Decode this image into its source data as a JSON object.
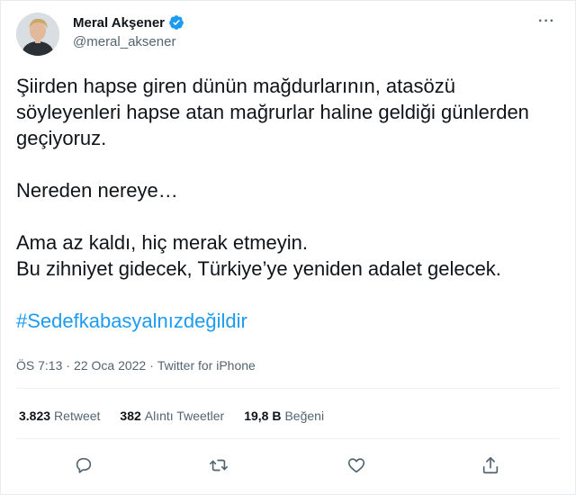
{
  "author": {
    "name": "Meral Akşener",
    "handle": "@meral_aksener",
    "verified_icon": "verified-badge-icon"
  },
  "tweet": {
    "paragraphs": [
      "Şiirden hapse giren dünün mağdurlarının, atasözü söyleyenleri hapse atan mağrurlar haline geldiği günlerden geçiyoruz.",
      "Nereden nereye…",
      "Ama az kaldı, hiç merak etmeyin.",
      "Bu zihniyet gidecek, Türkiye’ye yeniden adalet gelecek."
    ],
    "hashtag": "#Sedefkabasyalnızdeğildir"
  },
  "meta": {
    "time": "ÖS 7:13",
    "date": "22 Oca 2022",
    "source": "Twitter for iPhone"
  },
  "stats": {
    "retweets_value": "3.823",
    "retweets_label": "Retweet",
    "quotes_value": "382",
    "quotes_label": "Alıntı Tweetler",
    "likes_value": "19,8 B",
    "likes_label": "Beğeni"
  },
  "colors": {
    "accent": "#1d9bf0",
    "text": "#0f1419",
    "secondary": "#536471"
  }
}
